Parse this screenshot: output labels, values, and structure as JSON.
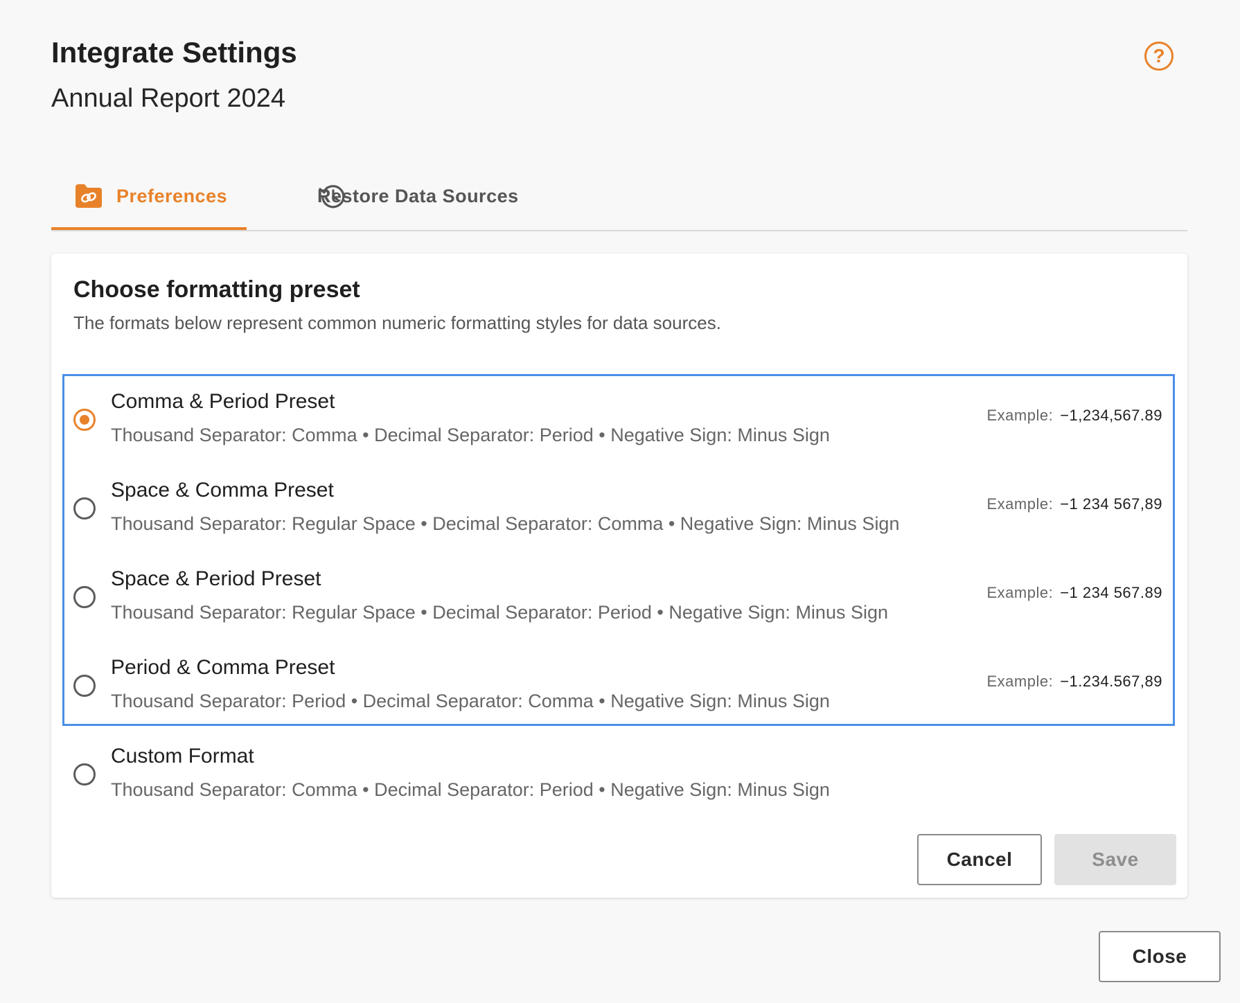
{
  "header": {
    "title": "Integrate Settings",
    "subtitle": "Annual Report 2024",
    "help_icon": "question-circle-icon",
    "help_glyph": "?"
  },
  "tabs": [
    {
      "label": "Preferences",
      "icon": "folder-link-icon",
      "active": true
    },
    {
      "label": "Restore Data Sources",
      "icon": "history-icon",
      "active": false
    }
  ],
  "card": {
    "title": "Choose formatting preset",
    "description": "The formats below represent common numeric formatting styles for data sources."
  },
  "options": [
    {
      "name": "Comma & Period Preset",
      "detail": "Thousand Separator: Comma • Decimal Separator: Period • Negative Sign: Minus Sign",
      "example_label": "Example:",
      "example_value": "−1,234,567.89",
      "checked": true
    },
    {
      "name": "Space & Comma Preset",
      "detail": "Thousand Separator: Regular Space • Decimal Separator: Comma • Negative Sign: Minus Sign",
      "example_label": "Example:",
      "example_value": "−1 234 567,89",
      "checked": false
    },
    {
      "name": "Space & Period Preset",
      "detail": "Thousand Separator: Regular Space • Decimal Separator: Period • Negative Sign: Minus Sign",
      "example_label": "Example:",
      "example_value": "−1 234 567.89",
      "checked": false
    },
    {
      "name": "Period & Comma Preset",
      "detail": "Thousand Separator: Period • Decimal Separator: Comma • Negative Sign: Minus Sign",
      "example_label": "Example:",
      "example_value": "−1.234.567,89",
      "checked": false
    },
    {
      "name": "Custom Format",
      "detail": "Thousand Separator: Comma • Decimal Separator: Period • Negative Sign: Minus Sign",
      "checked": false
    }
  ],
  "buttons": {
    "cancel": "Cancel",
    "save": "Save",
    "close": "Close"
  },
  "colors": {
    "accent": "#e8822a",
    "focus": "#4a8fe7",
    "disabled_bg": "#e2e2e2"
  }
}
